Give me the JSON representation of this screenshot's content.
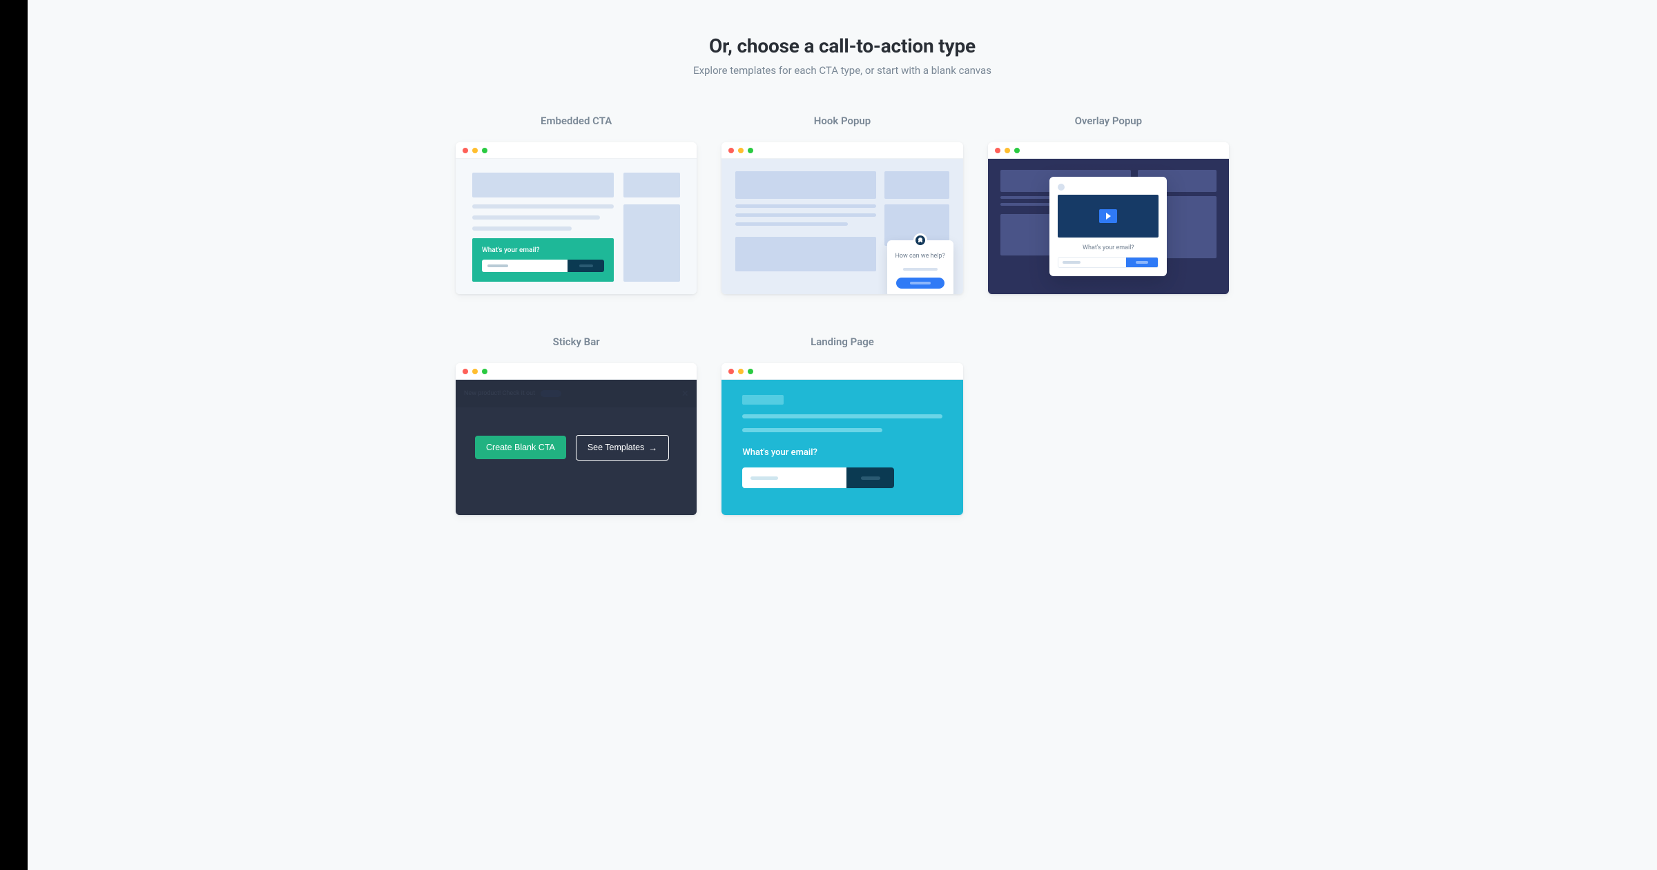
{
  "header": {
    "title": "Or, choose a call-to-action type",
    "subtitle": "Explore templates for each CTA type, or start with a blank canvas"
  },
  "cards": {
    "embedded": {
      "title": "Embedded CTA",
      "widget_label": "What's your email?"
    },
    "hook": {
      "title": "Hook Popup",
      "popup_text": "How can we help?"
    },
    "overlay": {
      "title": "Overlay Popup",
      "modal_label": "What's your email?"
    },
    "sticky": {
      "title": "Sticky Bar",
      "bar_text": "New product!  Check it out",
      "close_glyph": "✕",
      "create_label": "Create Blank CTA",
      "templates_label": "See Templates",
      "arrow_glyph": "→"
    },
    "landing": {
      "title": "Landing Page",
      "prompt_label": "What's your email?"
    }
  }
}
